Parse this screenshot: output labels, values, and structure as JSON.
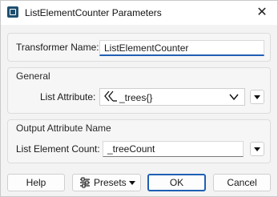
{
  "window": {
    "title": "ListElementCounter Parameters",
    "close_label": "✕"
  },
  "general_top": {
    "transformer_name_label": "Transformer Name:",
    "transformer_name_value": "ListElementCounter"
  },
  "general": {
    "title": "General",
    "list_attribute_label": "List Attribute:",
    "list_attribute_value": "_trees{}"
  },
  "output": {
    "title": "Output Attribute Name",
    "list_element_count_label": "List Element Count:",
    "list_element_count_value": "_treeCount"
  },
  "buttons": {
    "help": "Help",
    "presets": "Presets",
    "ok": "OK",
    "cancel": "Cancel"
  },
  "colors": {
    "accent": "#1f5fb4"
  }
}
